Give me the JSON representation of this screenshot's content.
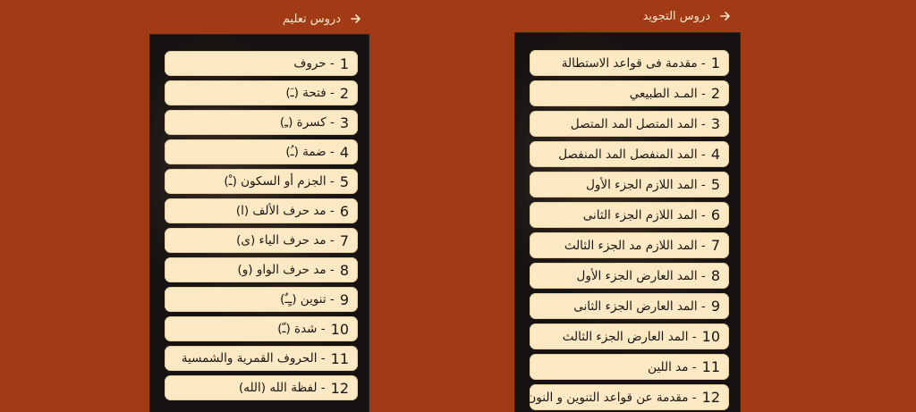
{
  "left_panel": {
    "title": "دروس تعليم",
    "icon": "arrow-right-icon",
    "items": [
      {
        "num": "1",
        "label": "- حروف"
      },
      {
        "num": "2",
        "label": "- فتحة (ـَ)"
      },
      {
        "num": "3",
        "label": "- كسرة (ـِ)"
      },
      {
        "num": "4",
        "label": "- ضمة (ـُ)"
      },
      {
        "num": "5",
        "label": "- الجزم أو السكون (ـْ)"
      },
      {
        "num": "6",
        "label": "- مد حرف الألف (ا)"
      },
      {
        "num": "7",
        "label": "- مد حرف الياء (ى)"
      },
      {
        "num": "8",
        "label": "- مد حرف الواو (و)"
      },
      {
        "num": "9",
        "label": "- تنوين (ـٍـٌ)"
      },
      {
        "num": "10",
        "label": "- شدة (ـّ)"
      },
      {
        "num": "11",
        "label": "- الحروف القمرية والشمسية"
      },
      {
        "num": "12",
        "label": "- لفظة الله (الله)"
      }
    ]
  },
  "right_panel": {
    "title": "دروس التجويد",
    "icon": "arrow-right-icon",
    "items": [
      {
        "num": "1",
        "label": "- مقدمة فى قواعد الاستطالة"
      },
      {
        "num": "2",
        "label": "- المـد الطبيعي"
      },
      {
        "num": "3",
        "label": "- المد المتصل المد المتصل"
      },
      {
        "num": "4",
        "label": "- المد المنفصل المد المنفصل"
      },
      {
        "num": "5",
        "label": "- المد اللازم الجزء الأول"
      },
      {
        "num": "6",
        "label": "- المد اللازم الجزء الثانى"
      },
      {
        "num": "7",
        "label": "- المد اللازم مد الجزء الثالث"
      },
      {
        "num": "8",
        "label": "- المد العارض الجزء الأول"
      },
      {
        "num": "9",
        "label": "- المد العارض الجزء الثانى"
      },
      {
        "num": "10",
        "label": "- المد العارض الجزء الثالث"
      },
      {
        "num": "11",
        "label": "- مد اللين"
      },
      {
        "num": "12",
        "label": "- مقدمة عن قواعد التنوين و النون ..."
      }
    ]
  }
}
